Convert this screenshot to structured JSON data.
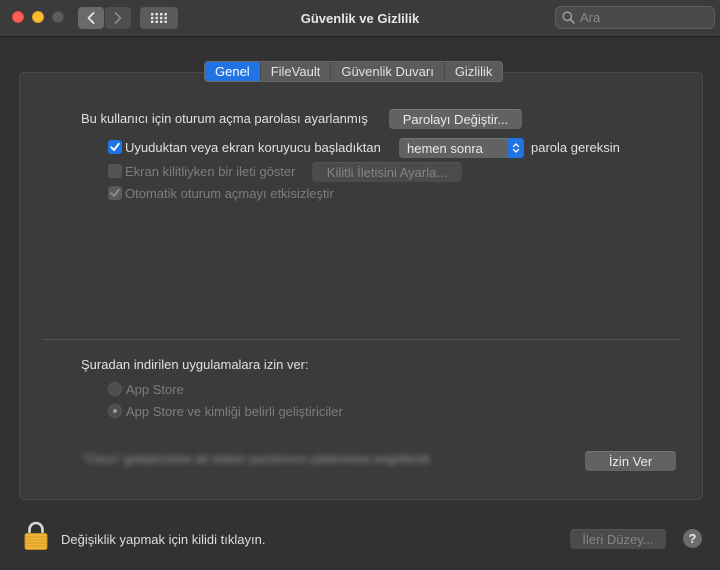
{
  "window": {
    "title": "Güvenlik ve Gizlilik"
  },
  "search": {
    "placeholder": "Ara"
  },
  "tabs": [
    {
      "label": "Genel",
      "active": true
    },
    {
      "label": "FileVault",
      "active": false
    },
    {
      "label": "Güvenlik Duvarı",
      "active": false
    },
    {
      "label": "Gizlilik",
      "active": false
    }
  ],
  "general": {
    "password_set_text": "Bu kullanıcı için oturum açma parolası ayarlanmış",
    "change_password_button": "Parolayı Değiştir...",
    "require_password": {
      "checked": true,
      "label": "Uyuduktan veya ekran koruyucu başladıktan",
      "select_value": "hemen sonra",
      "suffix": "parola gereksin"
    },
    "show_message": {
      "checked": false,
      "label": "Ekran kilitliyken bir ileti göster",
      "button": "Kilitli İletisini Ayarla..."
    },
    "disable_autologin": {
      "checked": true,
      "label": "Otomatik oturum açmayı etkisizleştir"
    }
  },
  "downloads": {
    "heading": "Şuradan indirilen uygulamalara izin ver:",
    "options": [
      {
        "label": "App Store",
        "selected": false
      },
      {
        "label": "App Store ve kimliği belirli geliştiriciler",
        "selected": true
      }
    ],
    "blurred_text": "\"Cisco\" geliştiricisine ait sistem yazılımının yüklenmesi engellendi.",
    "allow_button": "İzin Ver"
  },
  "footer": {
    "lock_text": "Değişiklik yapmak için kilidi tıklayın.",
    "advanced_button": "İleri Düzey...",
    "help": "?"
  },
  "colors": {
    "accent": "#1f73e5",
    "window_bg": "#323232",
    "panel_bg": "#3b3b3b"
  }
}
